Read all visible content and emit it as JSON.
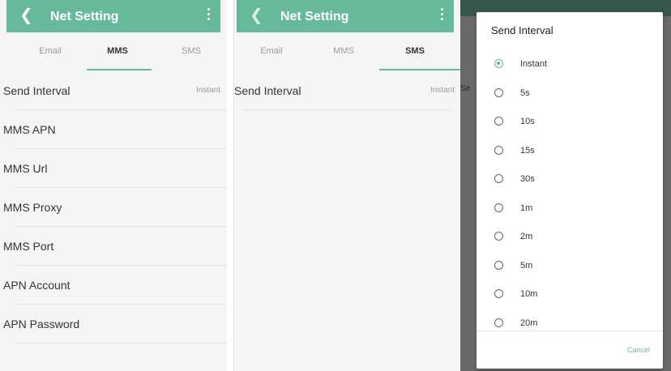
{
  "accent_color": "#66b99b",
  "app_bar": {
    "title": "Net Setting",
    "back_icon": "chevron-left-icon",
    "menu_icon": "more-vert-icon"
  },
  "tabs": [
    {
      "label": "Email"
    },
    {
      "label": "MMS"
    },
    {
      "label": "SMS"
    }
  ],
  "mms_screen": {
    "active_tab": "MMS",
    "rows": [
      {
        "label": "Send Interval",
        "value": "Instant"
      },
      {
        "label": "MMS APN",
        "value": ""
      },
      {
        "label": "MMS Url",
        "value": ""
      },
      {
        "label": "MMS Proxy",
        "value": ""
      },
      {
        "label": "MMS Port",
        "value": ""
      },
      {
        "label": "APN Account",
        "value": ""
      },
      {
        "label": "APN Password",
        "value": ""
      }
    ]
  },
  "sms_screen": {
    "active_tab": "SMS",
    "rows": [
      {
        "label": "Send Interval",
        "value": "Instant"
      }
    ]
  },
  "dialog_screen": {
    "background_text": "Se",
    "dialog": {
      "title": "Send Interval",
      "options": [
        {
          "label": "Instant",
          "selected": true
        },
        {
          "label": "5s",
          "selected": false
        },
        {
          "label": "10s",
          "selected": false
        },
        {
          "label": "15s",
          "selected": false
        },
        {
          "label": "30s",
          "selected": false
        },
        {
          "label": "1m",
          "selected": false
        },
        {
          "label": "2m",
          "selected": false
        },
        {
          "label": "5m",
          "selected": false
        },
        {
          "label": "10m",
          "selected": false
        },
        {
          "label": "20m",
          "selected": false
        }
      ],
      "cancel_label": "Cancel"
    }
  }
}
